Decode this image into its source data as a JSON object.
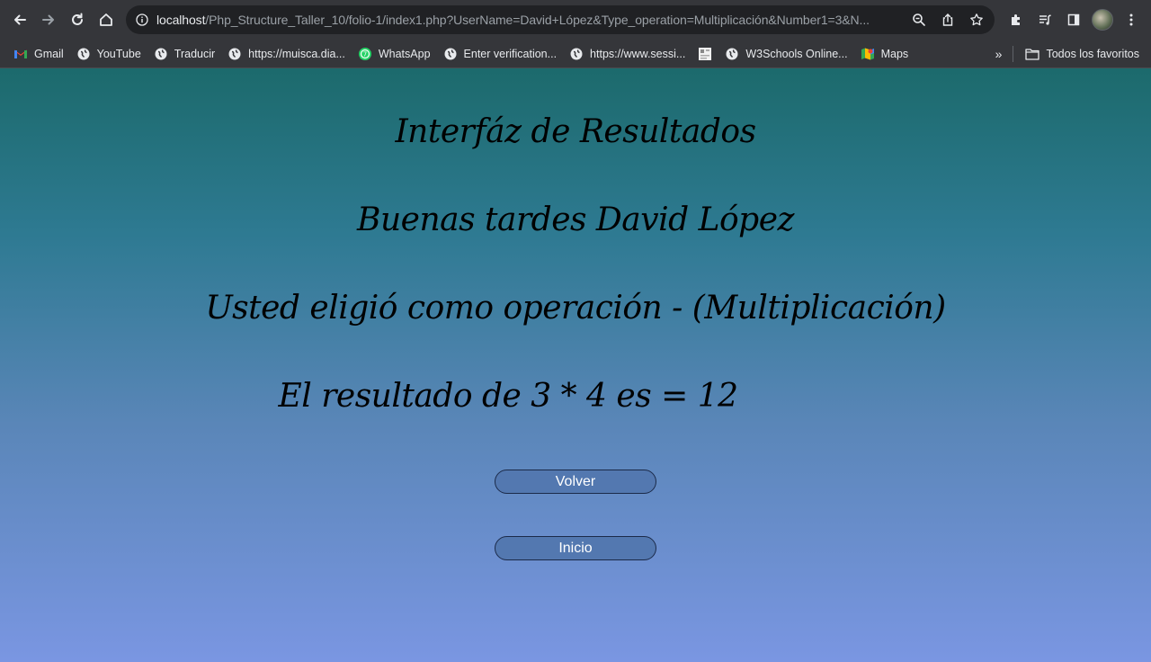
{
  "browser": {
    "url_host": "localhost",
    "url_path": "/Php_Structure_Taller_10/folio-1/index1.php?UserName=David+López&Type_operation=Multiplicación&Number1=3&N...",
    "icons": [
      "back-arrow-icon",
      "forward-arrow-icon",
      "reload-icon",
      "home-icon",
      "info-icon",
      "zoom-icon",
      "share-icon",
      "star-icon",
      "extensions-icon",
      "media-icon",
      "sidepanel-icon",
      "profile-avatar",
      "menu-dots-icon"
    ]
  },
  "bookmarks": {
    "items": [
      {
        "label": "Gmail",
        "icon": "gmail-icon"
      },
      {
        "label": "YouTube",
        "icon": "globe-icon"
      },
      {
        "label": "Traducir",
        "icon": "globe-icon"
      },
      {
        "label": "https://muisca.dia...",
        "icon": "globe-icon"
      },
      {
        "label": "WhatsApp",
        "icon": "whatsapp-icon"
      },
      {
        "label": "Enter verification...",
        "icon": "globe-icon"
      },
      {
        "label": "https://www.sessi...",
        "icon": "globe-icon"
      },
      {
        "label": "",
        "icon": "page-thumbnail-icon"
      },
      {
        "label": "W3Schools Online...",
        "icon": "globe-icon"
      },
      {
        "label": "Maps",
        "icon": "maps-icon"
      }
    ],
    "overflow": "»",
    "all_bookmarks": "Todos los favoritos"
  },
  "page": {
    "title": "Interfáz de Resultados",
    "greeting": "Buenas tardes David López",
    "operation": "Usted eligió como operación - (Multiplicación)",
    "result": "El resultado de 3 * 4 es = 12",
    "buttons": {
      "volver": "Volver",
      "inicio": "Inicio"
    }
  },
  "colors": {
    "gradient_top": "#1c6a6c",
    "gradient_bottom": "#7a96e2",
    "button_bg": "#5378b0",
    "toolbar_bg": "#35363a"
  }
}
